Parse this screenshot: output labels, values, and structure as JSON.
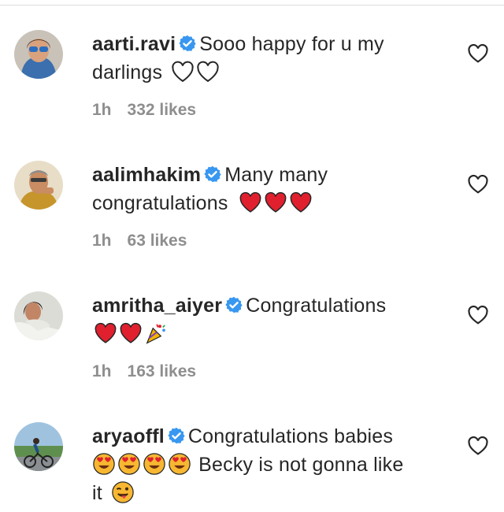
{
  "comments": [
    {
      "username": "aarti.ravi",
      "text": "Sooo happy for u my",
      "text2": "darlings",
      "time": "1h",
      "likes": "332 likes",
      "emojis": [
        "white-heart",
        "white-heart"
      ]
    },
    {
      "username": "aalimhakim",
      "text": "Many many",
      "text2": "congratulations",
      "time": "1h",
      "likes": "63 likes",
      "emojis": [
        "red-heart",
        "red-heart",
        "red-heart"
      ]
    },
    {
      "username": "amritha_aiyer",
      "text": "Congratulations",
      "text2": "",
      "time": "1h",
      "likes": "163 likes",
      "emojis": [
        "red-heart",
        "red-heart",
        "party-popper"
      ]
    },
    {
      "username": "aryaoffl",
      "text": "Congratulations babies",
      "text2": "Becky is not gonna like",
      "text3": "it",
      "emojis": [
        "heart-eyes-face",
        "heart-eyes-face",
        "heart-eyes-face",
        "heart-eyes-face",
        "winking-tongue-face"
      ]
    }
  ],
  "colors": {
    "text": "#262626",
    "meta": "#8e8e8e",
    "verified": "#3897f0",
    "heart_red": "#ed4956"
  },
  "icons": {
    "like_button": "heart-outline-icon",
    "verified": "verified-badge-icon"
  }
}
